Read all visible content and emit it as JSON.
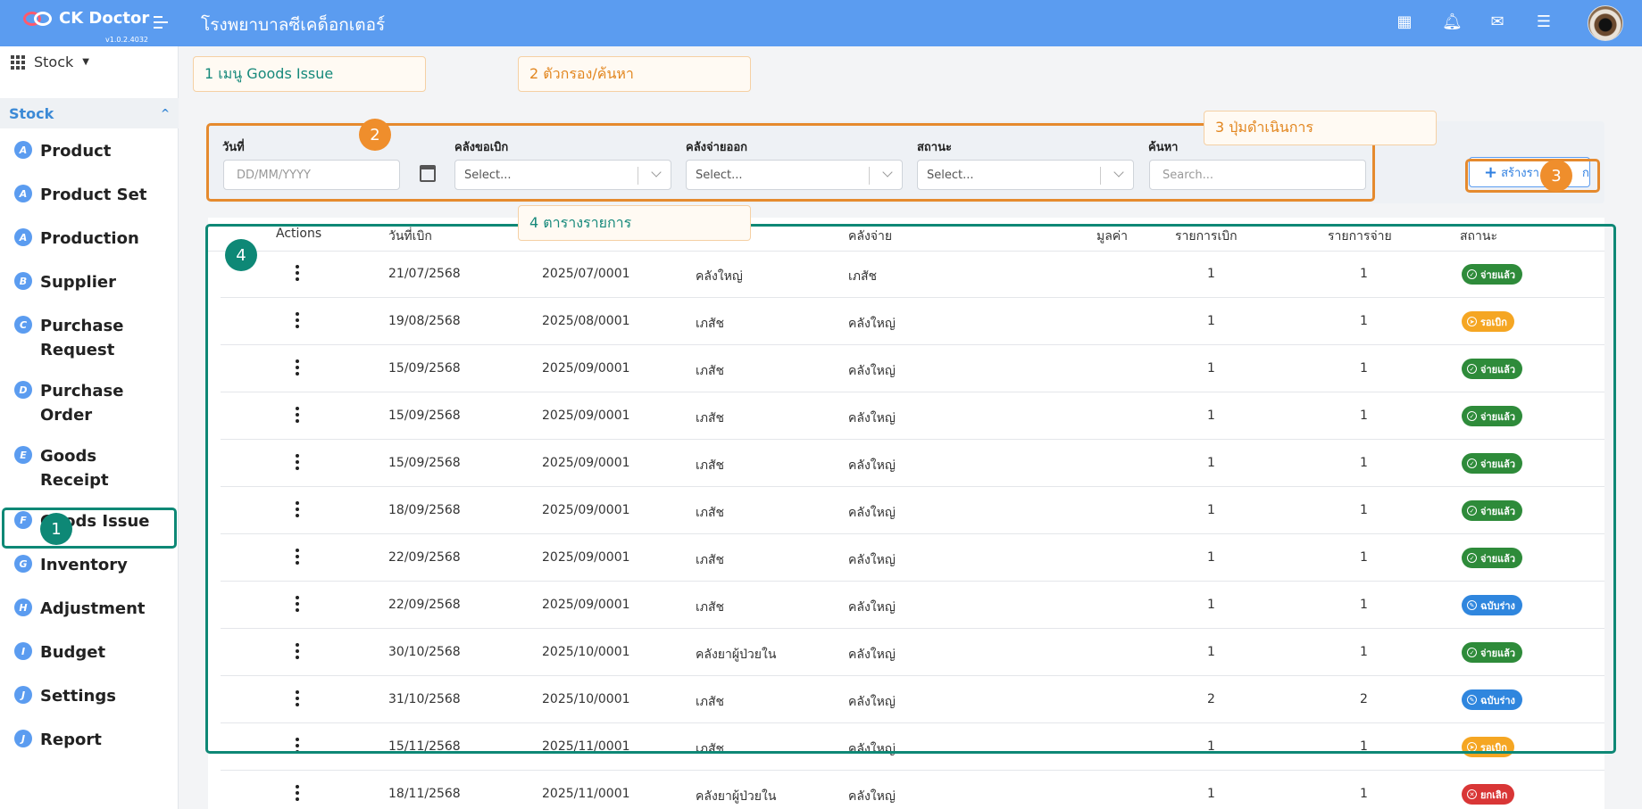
{
  "app": {
    "name": "CK Doctor",
    "version": "v1.0.2.4032",
    "hospital": "โรงพยาบาลซีเคด็อกเตอร์"
  },
  "top_icons": [
    "apps-grid-icon",
    "bell-icon",
    "mail-icon",
    "tasks-icon"
  ],
  "module": {
    "label": "Stock"
  },
  "section": {
    "label": "Stock"
  },
  "nav": [
    {
      "letter": "A",
      "label": "Product"
    },
    {
      "letter": "A",
      "label": "Product Set"
    },
    {
      "letter": "A",
      "label": "Production"
    },
    {
      "letter": "B",
      "label": "Supplier"
    },
    {
      "letter": "C",
      "label": "Purchase Request"
    },
    {
      "letter": "D",
      "label": "Purchase Order"
    },
    {
      "letter": "E",
      "label": "Goods Receipt"
    },
    {
      "letter": "F",
      "label": "Goods Issue",
      "active": true
    },
    {
      "letter": "G",
      "label": "Inventory"
    },
    {
      "letter": "H",
      "label": "Adjustment"
    },
    {
      "letter": "I",
      "label": "Budget"
    },
    {
      "letter": "J",
      "label": "Settings"
    },
    {
      "letter": "J",
      "label": "Report"
    }
  ],
  "callouts": {
    "c1": "1 เมนู Goods Issue",
    "c2": "2 ตัวกรอง/ค้นหา",
    "c3": "3 ปุ่มดำเนินการ",
    "c4": "4 ตารางรายการ",
    "n1": "1",
    "n2": "2",
    "n3": "3",
    "n4": "4"
  },
  "filters": {
    "date_label": "วันที่",
    "date_placeholder": "DD/MM/YYYY",
    "request_wh_label": "คลังขอเบิก",
    "request_wh_value": "Select...",
    "issue_wh_label": "คลังจ่ายออก",
    "issue_wh_value": "Select...",
    "status_label": "สถานะ",
    "status_value": "Select...",
    "search_label": "ค้นหา",
    "search_placeholder": "Search..."
  },
  "create_button": {
    "label": "สร้างรา",
    "tail": "ก"
  },
  "table": {
    "headers": [
      "Actions",
      "วันที่เบิก",
      "",
      "",
      "คลังจ่าย",
      "มูลค่า",
      "รายการเบิก",
      "รายการจ่าย",
      "สถานะ"
    ],
    "rows": [
      {
        "date": "21/07/2568",
        "doc": "2025/07/0001",
        "from": "คลังใหญ่",
        "to": "เภสัช",
        "req": "1",
        "iss": "1",
        "status": "จ่ายแล้ว",
        "kind": "paid"
      },
      {
        "date": "19/08/2568",
        "doc": "2025/08/0001",
        "from": "เภสัช",
        "to": "คลังใหญ่",
        "req": "1",
        "iss": "1",
        "status": "รอเบิก",
        "kind": "wait"
      },
      {
        "date": "15/09/2568",
        "doc": "2025/09/0001",
        "from": "เภสัช",
        "to": "คลังใหญ่",
        "req": "1",
        "iss": "1",
        "status": "จ่ายแล้ว",
        "kind": "paid"
      },
      {
        "date": "15/09/2568",
        "doc": "2025/09/0001",
        "from": "เภสัช",
        "to": "คลังใหญ่",
        "req": "1",
        "iss": "1",
        "status": "จ่ายแล้ว",
        "kind": "paid"
      },
      {
        "date": "15/09/2568",
        "doc": "2025/09/0001",
        "from": "เภสัช",
        "to": "คลังใหญ่",
        "req": "1",
        "iss": "1",
        "status": "จ่ายแล้ว",
        "kind": "paid"
      },
      {
        "date": "18/09/2568",
        "doc": "2025/09/0001",
        "from": "เภสัช",
        "to": "คลังใหญ่",
        "req": "1",
        "iss": "1",
        "status": "จ่ายแล้ว",
        "kind": "paid"
      },
      {
        "date": "22/09/2568",
        "doc": "2025/09/0001",
        "from": "เภสัช",
        "to": "คลังใหญ่",
        "req": "1",
        "iss": "1",
        "status": "จ่ายแล้ว",
        "kind": "paid"
      },
      {
        "date": "22/09/2568",
        "doc": "2025/09/0001",
        "from": "เภสัช",
        "to": "คลังใหญ่",
        "req": "1",
        "iss": "1",
        "status": "ฉบับร่าง",
        "kind": "draft"
      },
      {
        "date": "30/10/2568",
        "doc": "2025/10/0001",
        "from": "คลังยาผู้ป่วยใน",
        "to": "คลังใหญ่",
        "req": "1",
        "iss": "1",
        "status": "จ่ายแล้ว",
        "kind": "paid"
      },
      {
        "date": "31/10/2568",
        "doc": "2025/10/0001",
        "from": "เภสัช",
        "to": "คลังใหญ่",
        "req": "2",
        "iss": "2",
        "status": "ฉบับร่าง",
        "kind": "draft"
      },
      {
        "date": "15/11/2568",
        "doc": "2025/11/0001",
        "from": "เภสัช",
        "to": "คลังใหญ่",
        "req": "1",
        "iss": "1",
        "status": "รอเบิก",
        "kind": "wait"
      },
      {
        "date": "18/11/2568",
        "doc": "2025/11/0001",
        "from": "คลังยาผู้ป่วยใน",
        "to": "คลังใหญ่",
        "req": "1",
        "iss": "1",
        "status": "ยกเลิก",
        "kind": "cancel"
      }
    ]
  },
  "status_colors": {
    "paid": "#2e8b3a",
    "wait": "#f5a623",
    "draft": "#2f86de",
    "cancel": "#d93636"
  },
  "status_icons": {
    "paid": "check-circle-icon",
    "wait": "send-icon",
    "draft": "pencil-icon",
    "cancel": "x-circle-icon"
  }
}
